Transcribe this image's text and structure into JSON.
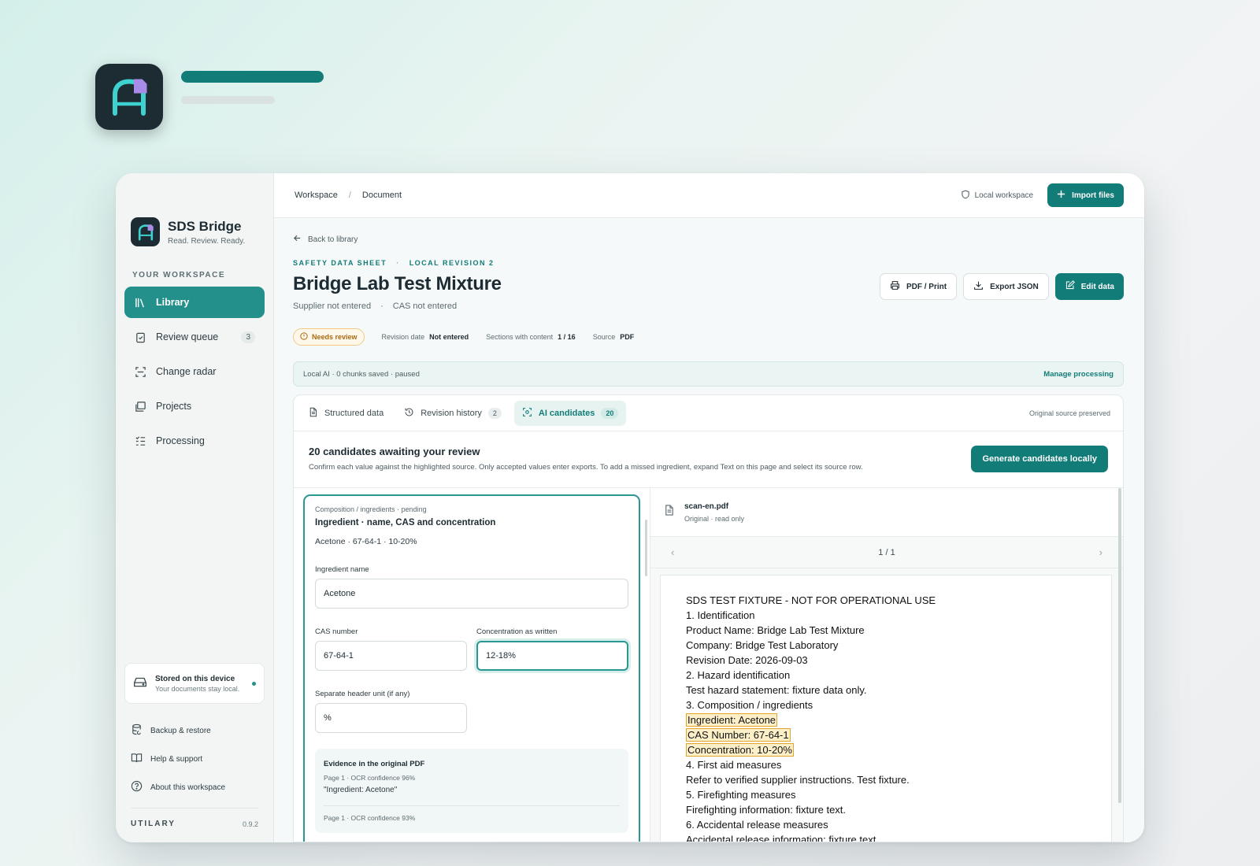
{
  "app": {
    "name": "SDS Bridge",
    "tagline": "Read. Review. Ready."
  },
  "sidebar": {
    "section_label": "YOUR WORKSPACE",
    "items": [
      {
        "label": "Library",
        "icon": "library-icon",
        "active": true
      },
      {
        "label": "Review queue",
        "icon": "clipboard-check-icon",
        "count": "3"
      },
      {
        "label": "Change radar",
        "icon": "scan-icon"
      },
      {
        "label": "Projects",
        "icon": "folders-icon"
      },
      {
        "label": "Processing",
        "icon": "list-checks-icon"
      }
    ],
    "storage": {
      "title": "Stored on this device",
      "subtitle": "Your documents stay local."
    },
    "footer_links": [
      {
        "label": "Backup & restore",
        "icon": "database-icon"
      },
      {
        "label": "Help & support",
        "icon": "book-icon"
      },
      {
        "label": "About this workspace",
        "icon": "help-circle-icon"
      }
    ],
    "brand_footer": "UTILARY",
    "version": "0.9.2"
  },
  "topbar": {
    "breadcrumb": [
      "Workspace",
      "Document"
    ],
    "local_workspace": "Local workspace",
    "import_label": "Import files"
  },
  "document": {
    "back_label": "Back to library",
    "kicker_type": "SAFETY DATA SHEET",
    "kicker_revision": "LOCAL REVISION 2",
    "title": "Bridge Lab Test Mixture",
    "supplier": "Supplier not entered",
    "cas": "CAS not entered",
    "actions": {
      "print": "PDF / Print",
      "export": "Export JSON",
      "edit": "Edit data"
    },
    "status": "Needs review",
    "meta": {
      "revision_label": "Revision date",
      "revision_value": "Not entered",
      "sections_label": "Sections with content",
      "sections_value": "1 / 16",
      "source_label": "Source",
      "source_value": "PDF"
    }
  },
  "ai_bar": {
    "text": "Local AI · 0 chunks saved · paused",
    "manage": "Manage processing"
  },
  "tabs": [
    {
      "label": "Structured data",
      "icon": "file-text-icon"
    },
    {
      "label": "Revision history",
      "icon": "history-icon",
      "count": "2"
    },
    {
      "label": "AI candidates",
      "icon": "ai-scan-icon",
      "count": "20",
      "active": true
    }
  ],
  "tabs_note": "Original source preserved",
  "candidates": {
    "title": "20 candidates awaiting your review",
    "description": "Confirm each value against the highlighted source. Only accepted values enter exports. To add a missed ingredient, expand Text on this page and select its source row.",
    "generate_label": "Generate candidates locally"
  },
  "card": {
    "kicker": "Composition / ingredients · pending",
    "title": "Ingredient · name, CAS and concentration",
    "summary": "Acetone · 67-64-1 · 10-20%",
    "fields": {
      "name_label": "Ingredient name",
      "name_value": "Acetone",
      "cas_label": "CAS number",
      "cas_value": "67-64-1",
      "conc_label": "Concentration as written",
      "conc_value": "12-18%",
      "unit_label": "Separate header unit (if any)",
      "unit_value": "%"
    },
    "evidence": {
      "title": "Evidence in the original PDF",
      "items": [
        {
          "meta": "Page 1 · OCR confidence 96%",
          "quote": "\"Ingredient: Acetone\""
        },
        {
          "meta": "Page 1 · OCR confidence 93%",
          "quote": ""
        }
      ]
    }
  },
  "viewer": {
    "file_name": "scan-en.pdf",
    "file_sub": "Original · read only",
    "page_indicator": "1 / 1",
    "lines": [
      {
        "text": "SDS TEST FIXTURE - NOT FOR OPERATIONAL USE"
      },
      {
        "text": "1. Identification"
      },
      {
        "text": "Product Name: Bridge Lab Test Mixture"
      },
      {
        "text": "Company: Bridge Test Laboratory"
      },
      {
        "text": "Revision Date: 2026-09-03"
      },
      {
        "text": "2. Hazard identification"
      },
      {
        "text": "Test hazard statement: fixture data only."
      },
      {
        "text": "3. Composition / ingredients"
      },
      {
        "text": "Ingredient: Acetone",
        "highlight": true
      },
      {
        "text": "CAS Number: 67-64-1",
        "highlight": true
      },
      {
        "text": "Concentration: 10-20%",
        "highlight": true
      },
      {
        "text": "4. First aid measures"
      },
      {
        "text": "Refer to verified supplier instructions. Test fixture."
      },
      {
        "text": "5. Firefighting measures"
      },
      {
        "text": "Firefighting information: fixture text."
      },
      {
        "text": "6. Accidental release measures"
      },
      {
        "text": "Accidental release information: fixture text."
      }
    ]
  },
  "colors": {
    "accent": "#127c78",
    "accent_light": "#23908b",
    "warning": "#a86a12",
    "highlight": "#e0a52a"
  }
}
